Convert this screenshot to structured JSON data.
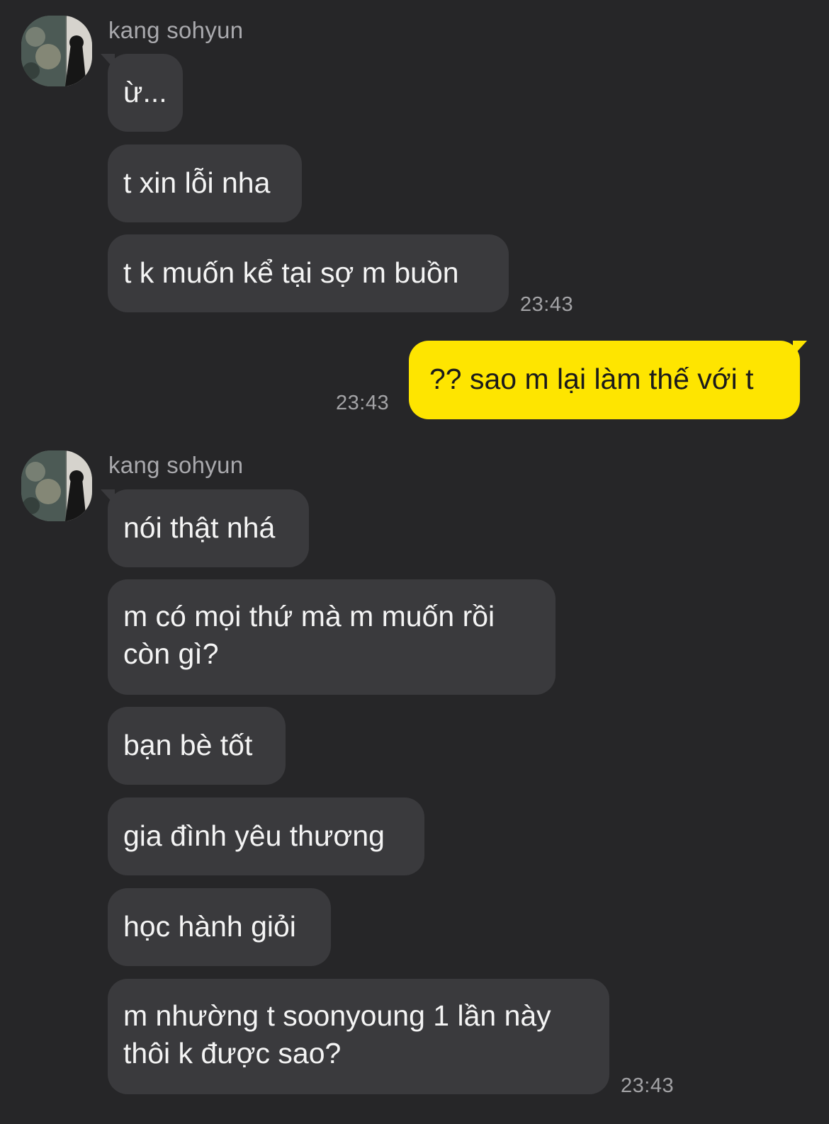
{
  "chat": {
    "groups": [
      {
        "sender": "kang sohyun",
        "messages": [
          "ừ...",
          "t xin lỗi nha",
          "t k muốn kể tại sợ m buồn"
        ],
        "time": "23:43"
      },
      {
        "mine": true,
        "messages": [
          "?? sao m lại làm thế với t"
        ],
        "time": "23:43"
      },
      {
        "sender": "kang sohyun",
        "messages": [
          "nói thật nhá",
          "m có mọi thứ mà m muốn rồi còn gì?",
          "bạn bè tốt",
          "gia đình yêu thương",
          "học hành giỏi",
          "m nhường t soonyoung 1 lần này thôi k được sao?"
        ],
        "time": "23:43"
      }
    ]
  },
  "colors": {
    "background": "#262628",
    "received_bubble": "#3a3a3d",
    "sent_bubble": "#fee500",
    "timestamp": "#a3a3a6"
  },
  "icons": {
    "avatar": "profile-photo"
  }
}
